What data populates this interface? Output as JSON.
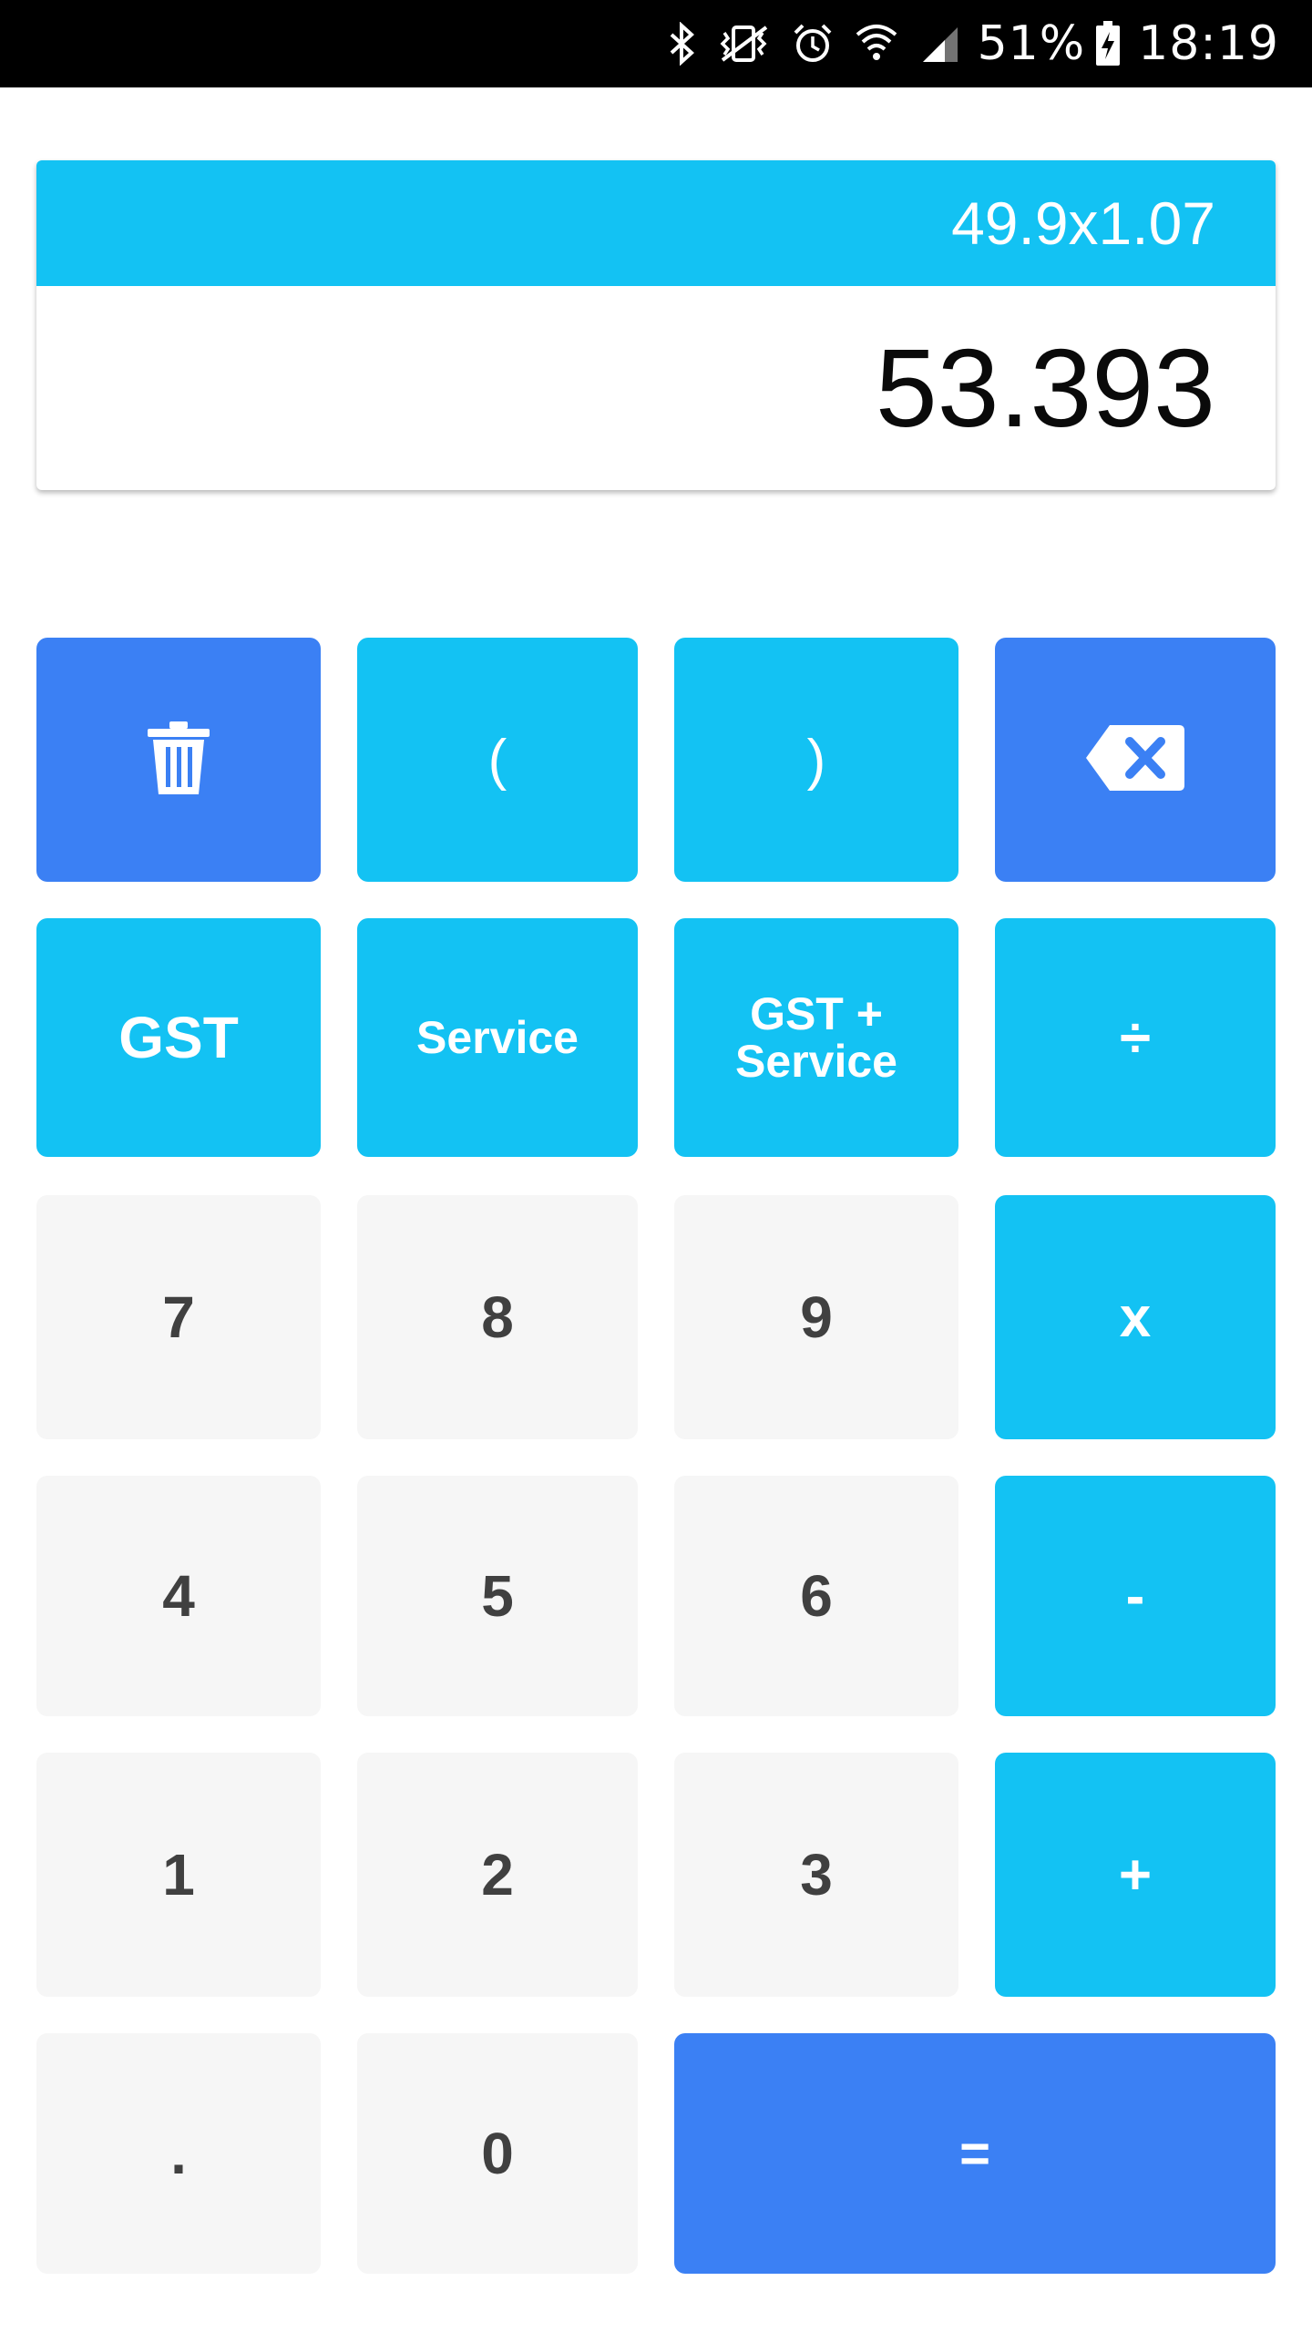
{
  "status_bar": {
    "battery": "51%",
    "time": "18:19",
    "icons": [
      "bluetooth-icon",
      "vibrate-icon",
      "alarm-icon",
      "wifi-icon",
      "signal-icon",
      "battery-charging-icon"
    ]
  },
  "display": {
    "expression": "49.9x1.07",
    "result": "53.393"
  },
  "keypad": {
    "clear_icon": "trash-icon",
    "open_paren": "(",
    "close_paren": ")",
    "backspace_icon": "backspace-icon",
    "gst": "GST",
    "service": "Service",
    "gst_service_line1": "GST +",
    "gst_service_line2": "Service",
    "divide": "÷",
    "seven": "7",
    "eight": "8",
    "nine": "9",
    "multiply": "x",
    "four": "4",
    "five": "5",
    "six": "6",
    "subtract": "-",
    "one": "1",
    "two": "2",
    "three": "3",
    "add": "+",
    "decimal": ".",
    "zero": "0",
    "equals": "="
  },
  "colors": {
    "accent_cyan": "#13c2f3",
    "accent_blue": "#3b80f4",
    "number_key_bg": "#f6f6f6",
    "number_key_text": "#404040"
  }
}
